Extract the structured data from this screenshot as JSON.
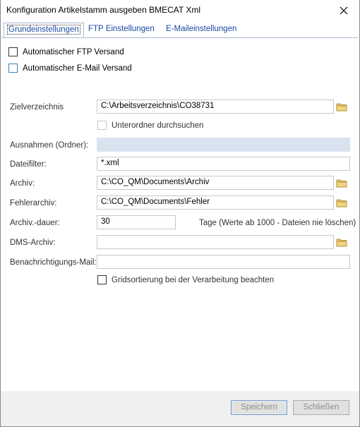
{
  "window": {
    "title": "Konfiguration Artikelstamm ausgeben BMECAT Xml"
  },
  "tabs": [
    {
      "label": "Grundeinstellungen",
      "active": true
    },
    {
      "label": "FTP Einstellungen",
      "active": false
    },
    {
      "label": "E-Maileinstellungen",
      "active": false
    }
  ],
  "options": {
    "ftp_versand": {
      "label": "Automatischer FTP Versand",
      "checked": false
    },
    "email_versand": {
      "label": "Automatischer E-Mail Versand",
      "checked": false
    }
  },
  "form": {
    "zielverzeichnis": {
      "label": "Zielverzeichnis",
      "value": "C:\\Arbeitsverzeichnis\\CO38731"
    },
    "unterordner": {
      "label": "Unterordner durchsuchen",
      "checked": false
    },
    "ausnahmen": {
      "label": "Ausnahmen (Ordner):",
      "value": ""
    },
    "dateifilter": {
      "label": "Dateifilter:",
      "value": "*.xml"
    },
    "archiv": {
      "label": "Archiv:",
      "value": "C:\\CO_QM\\Documents\\Archiv"
    },
    "fehlerarchiv": {
      "label": "Fehlerarchiv:",
      "value": "C:\\CO_QM\\Documents\\Fehler"
    },
    "archivdauer": {
      "label": "Archiv.-dauer:",
      "value": "30",
      "hint": "Tage (Werte ab 1000 - Dateien nie löschen)"
    },
    "dms_archiv": {
      "label": "DMS-Archiv:",
      "value": ""
    },
    "benachrichtigung": {
      "label": "Benachrichtigungs-Mail:",
      "value": ""
    },
    "gridsortierung": {
      "label": "Gridsortierung bei der Verarbeitung beachten",
      "checked": false
    }
  },
  "buttons": {
    "save": "Speichern",
    "close": "Schließen"
  },
  "colors": {
    "tab_text": "#1a4aa0",
    "disabled_field": "#d9e3f0",
    "footer_bg": "#f0f0f0"
  },
  "icons": {
    "close": "close-icon",
    "folder": "folder-icon"
  }
}
